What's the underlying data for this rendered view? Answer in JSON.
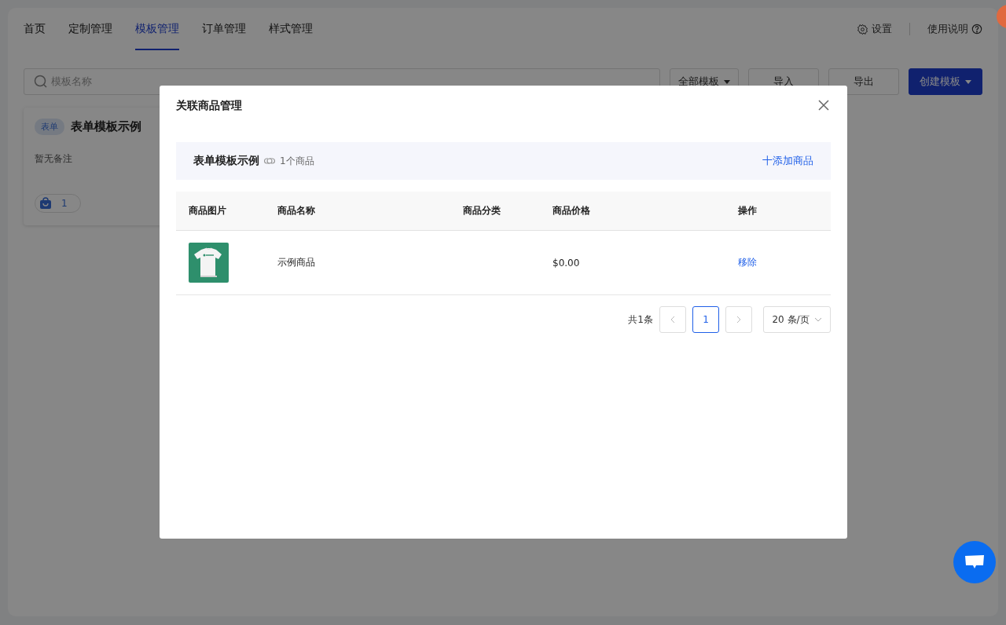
{
  "nav": {
    "tabs": [
      {
        "label": "首页",
        "selected": false
      },
      {
        "label": "定制管理",
        "selected": false
      },
      {
        "label": "模板管理",
        "selected": true
      },
      {
        "label": "订单管理",
        "selected": false
      },
      {
        "label": "样式管理",
        "selected": false
      }
    ],
    "settings": "设置",
    "help": "使用说明"
  },
  "toolbar": {
    "search": {
      "placeholder": "模板名称"
    },
    "filter": "全部模板",
    "import": "导入",
    "export": "导出",
    "create": "创建模板"
  },
  "template_card": {
    "tag": "表单",
    "title": "表单模板示例",
    "note": "暂无备注",
    "product_count": "1"
  },
  "modal": {
    "title": "关联商品管理",
    "template_name": "表单模板示例",
    "linked_count": "1个商品",
    "add_button": "十添加商品",
    "table": {
      "columns": [
        "商品图片",
        "商品名称",
        "商品分类",
        "商品价格",
        "操作"
      ],
      "rows": [
        {
          "name": "示例商品",
          "category": "",
          "price": "$0.00",
          "action": "移除"
        }
      ]
    },
    "pagination": {
      "total": "共1条",
      "pages": [
        {
          "label": "1",
          "selected": true
        }
      ],
      "page_size": "20 条/页"
    }
  }
}
